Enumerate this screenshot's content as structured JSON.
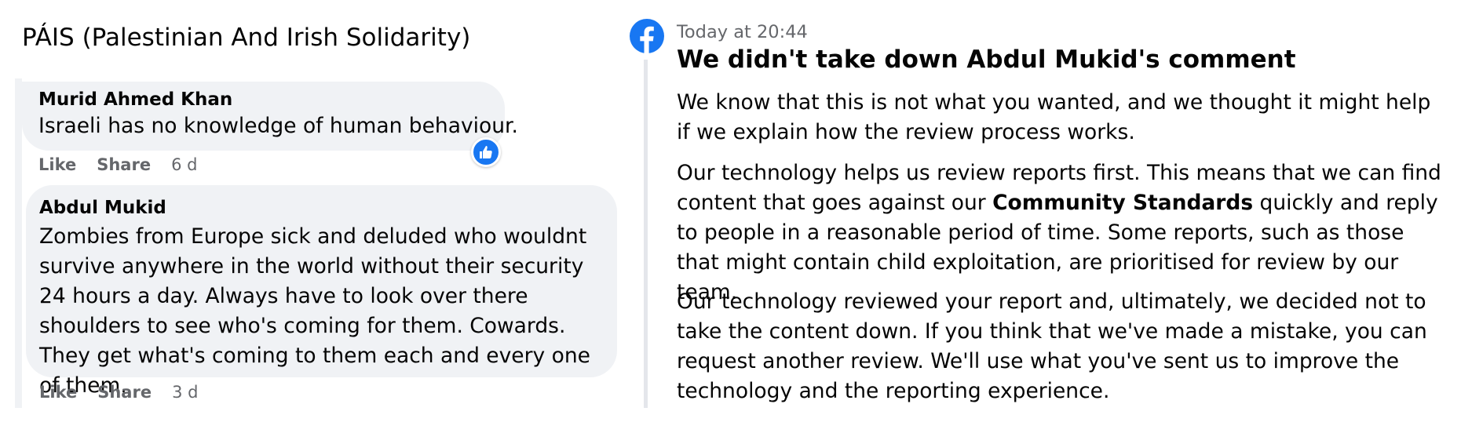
{
  "group": {
    "title": "PÁIS (Palestinian And Irish Solidarity)"
  },
  "comments": [
    {
      "author": "Murid Ahmed Khan",
      "text": "Israeli has no knowledge of human behaviour.",
      "like_label": "Like",
      "share_label": "Share",
      "time": "6 d",
      "reaction": "like-icon"
    },
    {
      "author": "Abdul Mukid",
      "text": "Zombies from Europe sick and deluded who wouldnt survive anywhere in the world without their security 24 hours a day. Always have to look over there shoulders to see who's coming for them. Cowards. They get what's coming to them each and every one of them.",
      "like_label": "Like",
      "share_label": "Share",
      "time": "3 d"
    }
  ],
  "notification": {
    "icon": "facebook-logo-icon",
    "timestamp": "Today at 20:44",
    "headline": "We didn't take down Abdul Mukid's comment",
    "p1": "We know that this is not what you wanted, and we thought it might help if we explain how the review process works.",
    "p2_before": "Our technology helps us review reports first. This means that we can find content that goes against our ",
    "p2_link": "Community Standards",
    "p2_after": " quickly and reply to people in a reasonable period of time. Some reports, such as those that might contain child exploitation, are prioritised for review by our team.",
    "p3": "Our technology reviewed your report and, ultimately, we decided not to take the content down. If you think that we've made a mistake, you can request another review. We'll use what you've sent us to improve the technology and the reporting experience."
  },
  "colors": {
    "facebook_blue": "#1877f2",
    "bubble_bg": "#f0f2f5",
    "secondary_text": "#65676b"
  }
}
